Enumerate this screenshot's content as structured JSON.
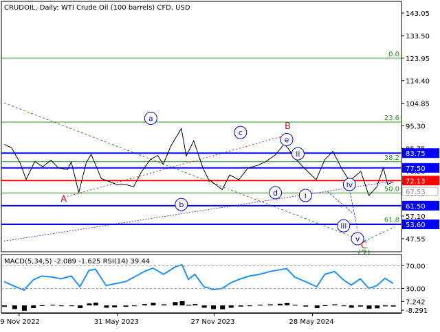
{
  "chart_data": [
    {
      "type": "line",
      "panel": "price",
      "title": "CRUDOIL, Daily:  WTI Crude Oil (100 barrels) CFD, USD",
      "ylim": [
        42,
        148
      ],
      "y_ticks": [
        "143.05",
        "133.50",
        "123.95",
        "114.40",
        "104.85",
        "95.30",
        "85.75",
        "76.20",
        "66.65",
        "57.10",
        "47.55"
      ],
      "x_ticks": [
        "29 Nov 2022",
        "31 May 2023",
        "27 Nov 2023",
        "28 May 2024"
      ],
      "x_tick_dates": [
        "2022-11-29",
        "2023-05-31",
        "2023-11-27",
        "2024-05-28"
      ],
      "x_range": [
        "2022-11-01",
        "2024-10-28"
      ],
      "series": [
        {
          "color": "#000000",
          "points": [
            [
              "2022-11-01",
              87.5
            ],
            [
              "2022-11-15",
              86.0
            ],
            [
              "2022-12-01",
              79.5
            ],
            [
              "2022-12-12",
              72.6
            ],
            [
              "2022-12-28",
              80.2
            ],
            [
              "2023-01-12",
              78.0
            ],
            [
              "2023-01-27",
              80.8
            ],
            [
              "2023-02-10",
              77.5
            ],
            [
              "2023-02-27",
              76.8
            ],
            [
              "2023-03-06",
              80.0
            ],
            [
              "2023-03-20",
              67.0
            ],
            [
              "2023-04-03",
              79.8
            ],
            [
              "2023-04-12",
              83.2
            ],
            [
              "2023-05-01",
              73.0
            ],
            [
              "2023-05-18",
              71.5
            ],
            [
              "2023-06-01",
              70.3
            ],
            [
              "2023-06-15",
              70.5
            ],
            [
              "2023-06-30",
              69.5
            ],
            [
              "2023-07-14",
              75.5
            ],
            [
              "2023-07-31",
              81.0
            ],
            [
              "2023-08-14",
              82.8
            ],
            [
              "2023-08-24",
              79.0
            ],
            [
              "2023-09-08",
              87.0
            ],
            [
              "2023-09-27",
              94.2
            ],
            [
              "2023-10-06",
              82.5
            ],
            [
              "2023-10-20",
              89.0
            ],
            [
              "2023-11-06",
              77.5
            ],
            [
              "2023-11-16",
              72.8
            ],
            [
              "2023-12-12",
              68.3
            ],
            [
              "2023-12-26",
              74.5
            ],
            [
              "2024-01-12",
              72.5
            ],
            [
              "2024-01-29",
              77.5
            ],
            [
              "2024-02-15",
              78.5
            ],
            [
              "2024-03-01",
              80.0
            ],
            [
              "2024-03-20",
              83.0
            ],
            [
              "2024-04-05",
              87.5
            ],
            [
              "2024-04-12",
              86.0
            ],
            [
              "2024-04-26",
              81.5
            ],
            [
              "2024-05-10",
              78.0
            ],
            [
              "2024-06-04",
              72.5
            ],
            [
              "2024-06-20",
              81.0
            ],
            [
              "2024-07-05",
              84.5
            ],
            [
              "2024-07-22",
              77.0
            ],
            [
              "2024-08-05",
              72.0
            ],
            [
              "2024-08-26",
              76.0
            ],
            [
              "2024-09-10",
              65.8
            ],
            [
              "2024-09-25",
              69.5
            ],
            [
              "2024-10-07",
              77.5
            ],
            [
              "2024-10-15",
              70.5
            ],
            [
              "2024-10-25",
              71.5
            ]
          ]
        }
      ],
      "horizontal_levels": [
        {
          "value": 83.75,
          "label": "83.75",
          "color": "#0000ff",
          "label_bg": "#0000ff"
        },
        {
          "value": 77.5,
          "label": "77.50",
          "color": "#0000ff",
          "label_bg": "#0000ff"
        },
        {
          "value": 72.13,
          "label": "72.13",
          "color": "#ff0000",
          "label_bg": "#ff0000",
          "role": "current price"
        },
        {
          "value": 61.5,
          "label": "61.50",
          "color": "#0000ff",
          "label_bg": "#0000ff"
        },
        {
          "value": 53.6,
          "label": "53.60",
          "color": "#0000ff",
          "label_bg": "#0000ff"
        }
      ],
      "overlap_price_label": {
        "value": 67.53,
        "label": "67.53"
      },
      "fibonacci_levels": [
        {
          "value": 123.95,
          "label": "0.0"
        },
        {
          "value": 96.9,
          "label": "23.6"
        },
        {
          "value": 80.1,
          "label": "38.2"
        },
        {
          "value": 66.9,
          "label": "50.0"
        },
        {
          "value": 53.8,
          "label": "61.8"
        }
      ],
      "wave_labels": [
        {
          "text": "a",
          "date": "2023-08-01",
          "value": 98.5,
          "style": "circle-blue"
        },
        {
          "text": "b",
          "date": "2023-09-27",
          "value": 62.0,
          "style": "circle-blue"
        },
        {
          "text": "c",
          "date": "2024-01-15",
          "value": 92.5,
          "style": "circle-blue"
        },
        {
          "text": "d",
          "date": "2024-03-20",
          "value": 67.0,
          "style": "circle-blue"
        },
        {
          "text": "e",
          "date": "2024-04-10",
          "value": 89.5,
          "style": "circle-blue"
        },
        {
          "text": "ii",
          "date": "2024-05-01",
          "value": 83.5,
          "style": "circle-blue"
        },
        {
          "text": "i",
          "date": "2024-05-15",
          "value": 65.8,
          "style": "circle-blue"
        },
        {
          "text": "iii",
          "date": "2024-07-25",
          "value": 53.0,
          "style": "circle-blue"
        },
        {
          "text": "iv",
          "date": "2024-08-05",
          "value": 70.5,
          "style": "circle-blue"
        },
        {
          "text": "v",
          "date": "2024-08-20",
          "value": 47.5,
          "style": "circle-blue"
        },
        {
          "text": "A",
          "date": "2023-02-20",
          "value": 63.0,
          "style": "plain-red"
        },
        {
          "text": "B",
          "date": "2024-04-12",
          "value": 94.0,
          "style": "plain-red"
        },
        {
          "text": "C",
          "date": "2024-09-01",
          "value": 43.5,
          "style": "plain-red"
        },
        {
          "text": "(2)",
          "date": "2024-09-01",
          "value": 40.0,
          "style": "plain-green"
        }
      ]
    },
    {
      "type": "bar",
      "panel": "indicator",
      "title": "MACD(5,34,5) -2.089 -1.625 RSI(14) 39.44",
      "ylim": [
        -13,
        90
      ],
      "y_ticks": [
        "7.242",
        "70.00",
        "30.00",
        "-8.291"
      ],
      "macd_histogram": [
        [
          "2022-11-01",
          -2.5
        ],
        [
          "2022-11-20",
          -6.5
        ],
        [
          "2022-12-08",
          -9.5
        ],
        [
          "2022-12-25",
          -4.5
        ],
        [
          "2023-01-10",
          0.5
        ],
        [
          "2023-01-30",
          1.0
        ],
        [
          "2023-02-15",
          -0.8
        ],
        [
          "2023-03-06",
          -0.3
        ],
        [
          "2023-03-22",
          -4.5
        ],
        [
          "2023-04-08",
          3.5
        ],
        [
          "2023-04-20",
          4.8
        ],
        [
          "2023-05-10",
          -4.0
        ],
        [
          "2023-05-25",
          -3.5
        ],
        [
          "2023-06-15",
          -2.5
        ],
        [
          "2023-07-01",
          -0.5
        ],
        [
          "2023-07-20",
          2.5
        ],
        [
          "2023-08-05",
          4.5
        ],
        [
          "2023-08-25",
          2.0
        ],
        [
          "2023-09-15",
          6.0
        ],
        [
          "2023-09-28",
          7.5
        ],
        [
          "2023-10-10",
          1.0
        ],
        [
          "2023-10-22",
          2.5
        ],
        [
          "2023-11-08",
          -4.0
        ],
        [
          "2023-11-25",
          -6.5
        ],
        [
          "2023-12-12",
          -7.0
        ],
        [
          "2023-12-28",
          -4.0
        ],
        [
          "2024-01-15",
          -2.0
        ],
        [
          "2024-02-01",
          -1.0
        ],
        [
          "2024-02-20",
          1.0
        ],
        [
          "2024-03-10",
          2.0
        ],
        [
          "2024-03-28",
          3.0
        ],
        [
          "2024-04-10",
          4.2
        ],
        [
          "2024-04-25",
          1.0
        ],
        [
          "2024-05-15",
          -2.0
        ],
        [
          "2024-06-05",
          -4.5
        ],
        [
          "2024-06-20",
          0.5
        ],
        [
          "2024-07-08",
          2.0
        ],
        [
          "2024-07-25",
          -0.5
        ],
        [
          "2024-08-08",
          -4.0
        ],
        [
          "2024-08-25",
          -2.0
        ],
        [
          "2024-09-10",
          -6.0
        ],
        [
          "2024-09-25",
          -5.0
        ],
        [
          "2024-10-10",
          -1.5
        ],
        [
          "2024-10-25",
          -2.0
        ]
      ],
      "rsi": [
        [
          "2022-11-01",
          42
        ],
        [
          "2022-11-20",
          34
        ],
        [
          "2022-12-08",
          27
        ],
        [
          "2022-12-25",
          45
        ],
        [
          "2023-01-10",
          52
        ],
        [
          "2023-01-30",
          50
        ],
        [
          "2023-02-15",
          47
        ],
        [
          "2023-03-06",
          52
        ],
        [
          "2023-03-22",
          33
        ],
        [
          "2023-04-08",
          62
        ],
        [
          "2023-04-20",
          64
        ],
        [
          "2023-05-10",
          35
        ],
        [
          "2023-05-25",
          38
        ],
        [
          "2023-06-15",
          42
        ],
        [
          "2023-07-01",
          50
        ],
        [
          "2023-07-20",
          60
        ],
        [
          "2023-08-05",
          66
        ],
        [
          "2023-08-25",
          55
        ],
        [
          "2023-09-15",
          68
        ],
        [
          "2023-09-28",
          72
        ],
        [
          "2023-10-10",
          46
        ],
        [
          "2023-10-22",
          55
        ],
        [
          "2023-11-08",
          33
        ],
        [
          "2023-11-25",
          28
        ],
        [
          "2023-12-12",
          30
        ],
        [
          "2023-12-28",
          40
        ],
        [
          "2024-01-15",
          47
        ],
        [
          "2024-02-01",
          52
        ],
        [
          "2024-02-20",
          55
        ],
        [
          "2024-03-10",
          60
        ],
        [
          "2024-03-28",
          63
        ],
        [
          "2024-04-10",
          65
        ],
        [
          "2024-04-25",
          50
        ],
        [
          "2024-05-15",
          42
        ],
        [
          "2024-06-05",
          33
        ],
        [
          "2024-06-20",
          55
        ],
        [
          "2024-07-08",
          60
        ],
        [
          "2024-07-25",
          45
        ],
        [
          "2024-08-08",
          36
        ],
        [
          "2024-08-25",
          47
        ],
        [
          "2024-09-10",
          30
        ],
        [
          "2024-09-25",
          35
        ],
        [
          "2024-10-10",
          48
        ],
        [
          "2024-10-25",
          39
        ]
      ],
      "colors": {
        "histogram": "#000000",
        "rsi": "#1e90ff",
        "signal": "#ff0000"
      }
    }
  ],
  "colors": {
    "axis": "#000000",
    "label_text": "#ffffff",
    "fib_line": "#2e8b22",
    "fib_text": "#2e8b22",
    "wave_circle": "#0000cc",
    "red_label": "#b22222",
    "green_label": "#1f8f1f"
  }
}
